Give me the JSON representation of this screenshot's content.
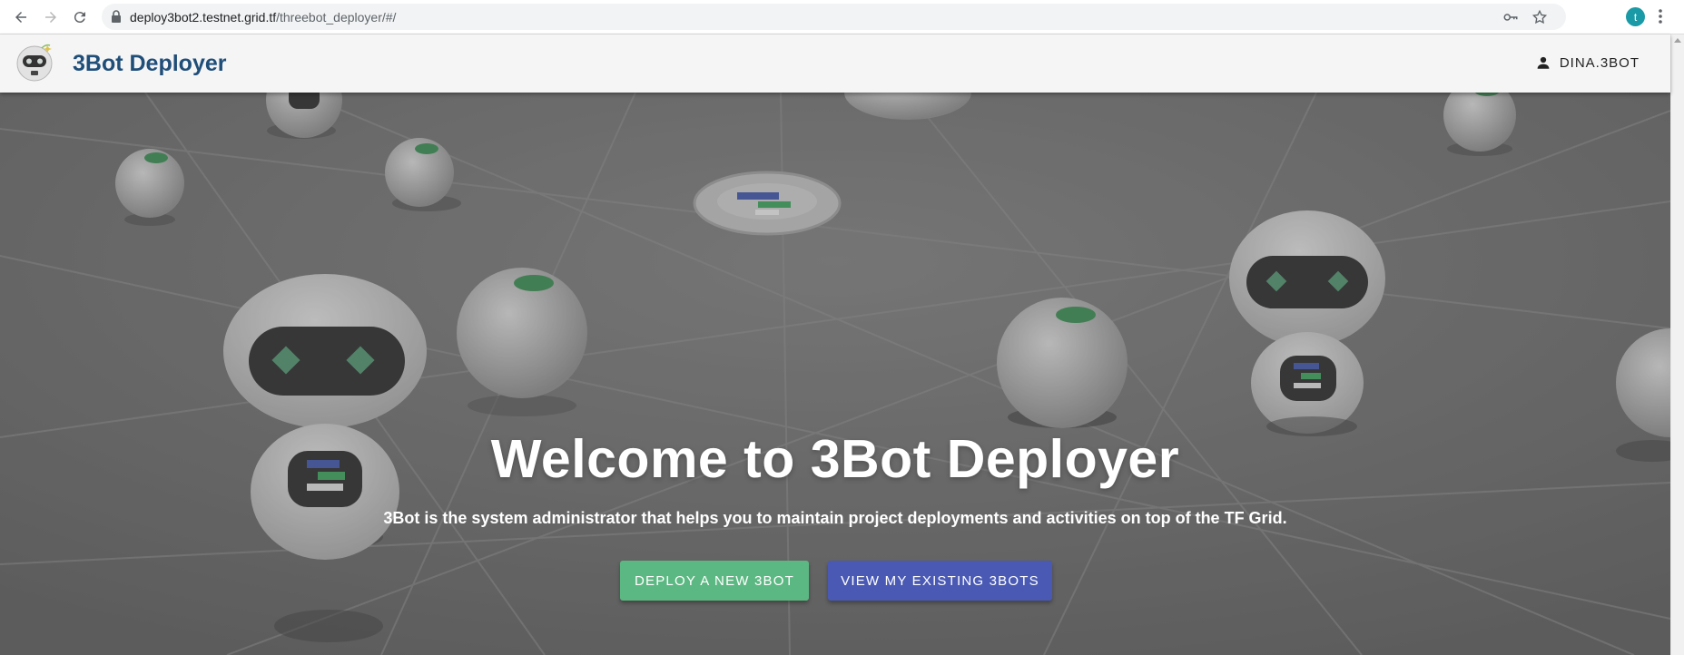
{
  "browser": {
    "url_domain": "deploy3bot2.testnet.grid.tf",
    "url_path": "/threebot_deployer/#/",
    "profile_initial": "t"
  },
  "header": {
    "brand": "3Bot Deployer",
    "user": "DINA.3BOT"
  },
  "hero": {
    "title": "Welcome to 3Bot Deployer",
    "subtitle": "3Bot is the system administrator that helps you to maintain project deployments and activities on top of the TF Grid.",
    "deploy_button": "DEPLOY A NEW 3BOT",
    "view_button": "VIEW MY EXISTING 3BOTS"
  },
  "colors": {
    "brand_text": "#1f4e79",
    "deploy_button": "#5cb882",
    "view_button": "#4a5ab4",
    "hero_background": "#6c6c6c"
  },
  "icons": [
    "back-arrow-icon",
    "forward-arrow-icon",
    "reload-icon",
    "lock-icon",
    "key-icon",
    "star-icon",
    "kebab-menu-icon",
    "person-icon",
    "robot-logo-icon"
  ]
}
